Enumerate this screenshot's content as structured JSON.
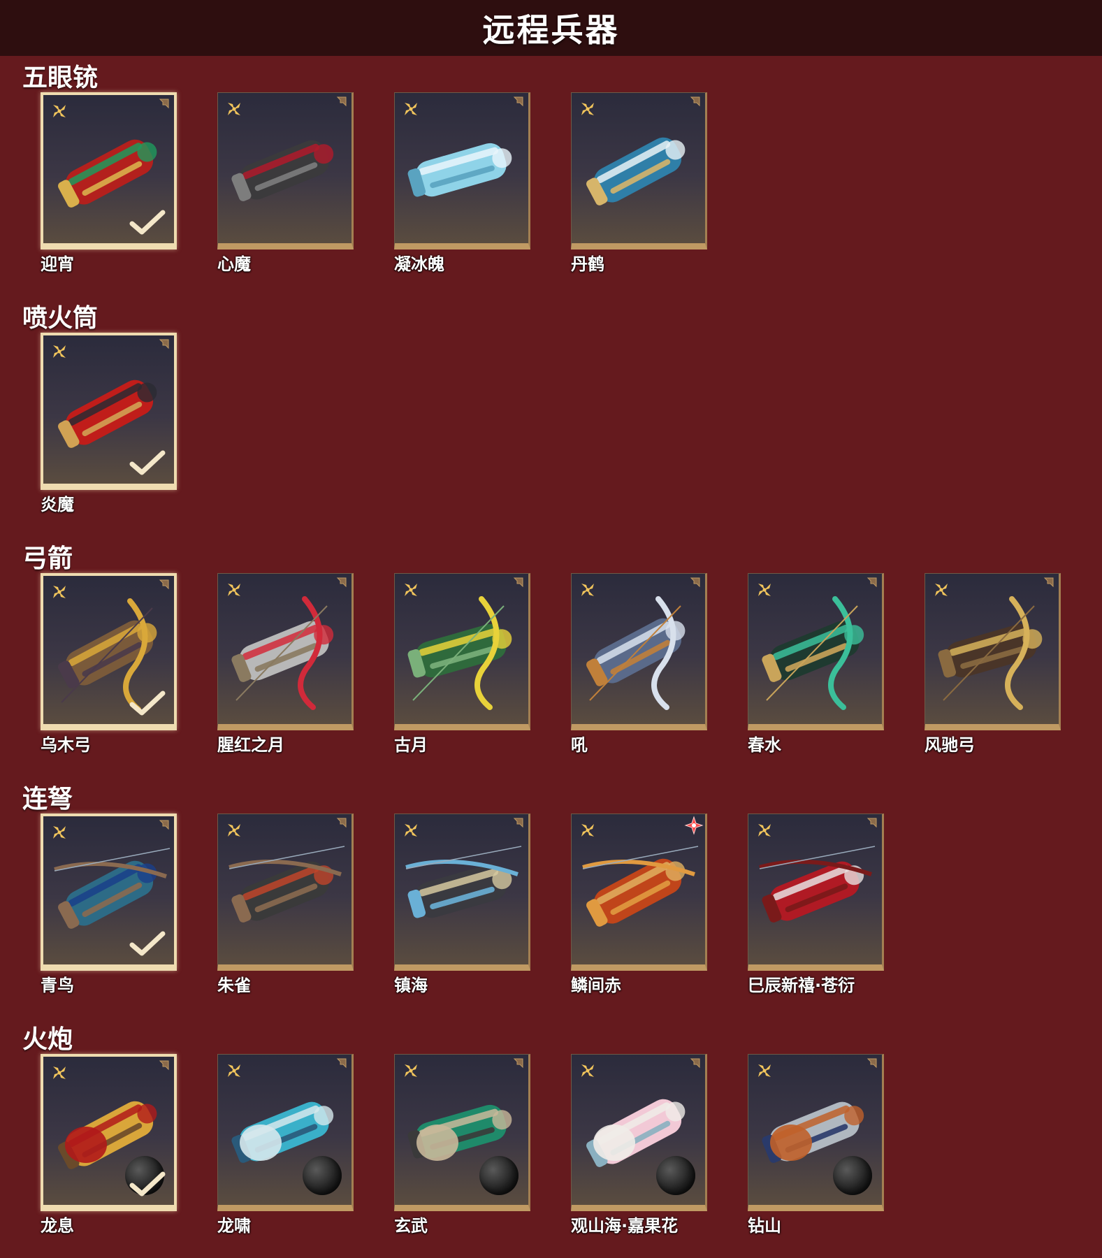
{
  "page_title": "远程兵器",
  "colors": {
    "background": "#651a1e",
    "header": "#2e0e0f",
    "card_border": "#c09a63",
    "selected_border": "#efdcb0",
    "rarity": "#f2c55c"
  },
  "sections": [
    {
      "title": "五眼铳",
      "items": [
        {
          "name": "迎宵",
          "selected": true,
          "theme": [
            "#b3201d",
            "#1f9a5c",
            "#d9b04c"
          ]
        },
        {
          "name": "心魔",
          "selected": false,
          "theme": [
            "#3b3a3c",
            "#b01a2a",
            "#7d7d7d"
          ]
        },
        {
          "name": "凝冰魄",
          "selected": false,
          "theme": [
            "#8fd3e8",
            "#e9f5fb",
            "#5aa3c0"
          ]
        },
        {
          "name": "丹鹤",
          "selected": false,
          "theme": [
            "#2f7fa8",
            "#e8f2f6",
            "#d6b56a"
          ]
        }
      ]
    },
    {
      "title": "喷火筒",
      "items": [
        {
          "name": "炎魔",
          "selected": true,
          "theme": [
            "#c01d1a",
            "#2a2a32",
            "#d1a254"
          ]
        }
      ]
    },
    {
      "title": "弓箭",
      "items": [
        {
          "name": "乌木弓",
          "selected": true,
          "theme": [
            "#7a5a3a",
            "#d9a83a",
            "#4a3a4a"
          ]
        },
        {
          "name": "腥红之月",
          "selected": false,
          "theme": [
            "#b8b8b8",
            "#d12a3a",
            "#8a7a60"
          ]
        },
        {
          "name": "古月",
          "selected": false,
          "theme": [
            "#2f6a3c",
            "#e8d23a",
            "#7ab07a"
          ]
        },
        {
          "name": "吼",
          "selected": false,
          "theme": [
            "#5a6a8a",
            "#d8e0ec",
            "#c0803a"
          ]
        },
        {
          "name": "春水",
          "selected": false,
          "theme": [
            "#1f3a30",
            "#3bbf9a",
            "#c9a45a"
          ]
        },
        {
          "name": "风驰弓",
          "selected": false,
          "theme": [
            "#4a3528",
            "#d6b15a",
            "#8a6a40"
          ]
        }
      ]
    },
    {
      "title": "连弩",
      "items": [
        {
          "name": "青鸟",
          "selected": true,
          "theme": [
            "#2d6b86",
            "#1a3f8a",
            "#8a6a50"
          ]
        },
        {
          "name": "朱雀",
          "selected": false,
          "theme": [
            "#3a3a3a",
            "#c0452a",
            "#8a6a50"
          ]
        },
        {
          "name": "镇海",
          "selected": false,
          "theme": [
            "#3a3a40",
            "#d6c9a0",
            "#6ab0d6"
          ]
        },
        {
          "name": "鳞间赤",
          "selected": false,
          "new": true,
          "theme": [
            "#c0451a",
            "#e0b060",
            "#e09a40"
          ]
        },
        {
          "name": "巳辰新禧·苍衍",
          "selected": false,
          "theme": [
            "#b01a24",
            "#e8e0e0",
            "#7a1a1a"
          ]
        }
      ]
    },
    {
      "title": "火炮",
      "items": [
        {
          "name": "龙息",
          "selected": true,
          "ammo": true,
          "theme": [
            "#d9a63a",
            "#b01a1a",
            "#6a4a2a"
          ]
        },
        {
          "name": "龙啸",
          "selected": false,
          "ammo": true,
          "theme": [
            "#3ab0c9",
            "#d6e8ec",
            "#2a5a7a"
          ]
        },
        {
          "name": "玄武",
          "selected": false,
          "ammo": true,
          "theme": [
            "#1f8a6a",
            "#c9b89a",
            "#3a3a3a"
          ]
        },
        {
          "name": "观山海·嘉果花",
          "selected": false,
          "ammo": true,
          "theme": [
            "#f2c9d6",
            "#f0ece8",
            "#8ab0c0"
          ]
        },
        {
          "name": "钻山",
          "selected": false,
          "ammo": true,
          "theme": [
            "#b0b8c0",
            "#c0602a",
            "#2a3a6a"
          ]
        }
      ]
    }
  ]
}
